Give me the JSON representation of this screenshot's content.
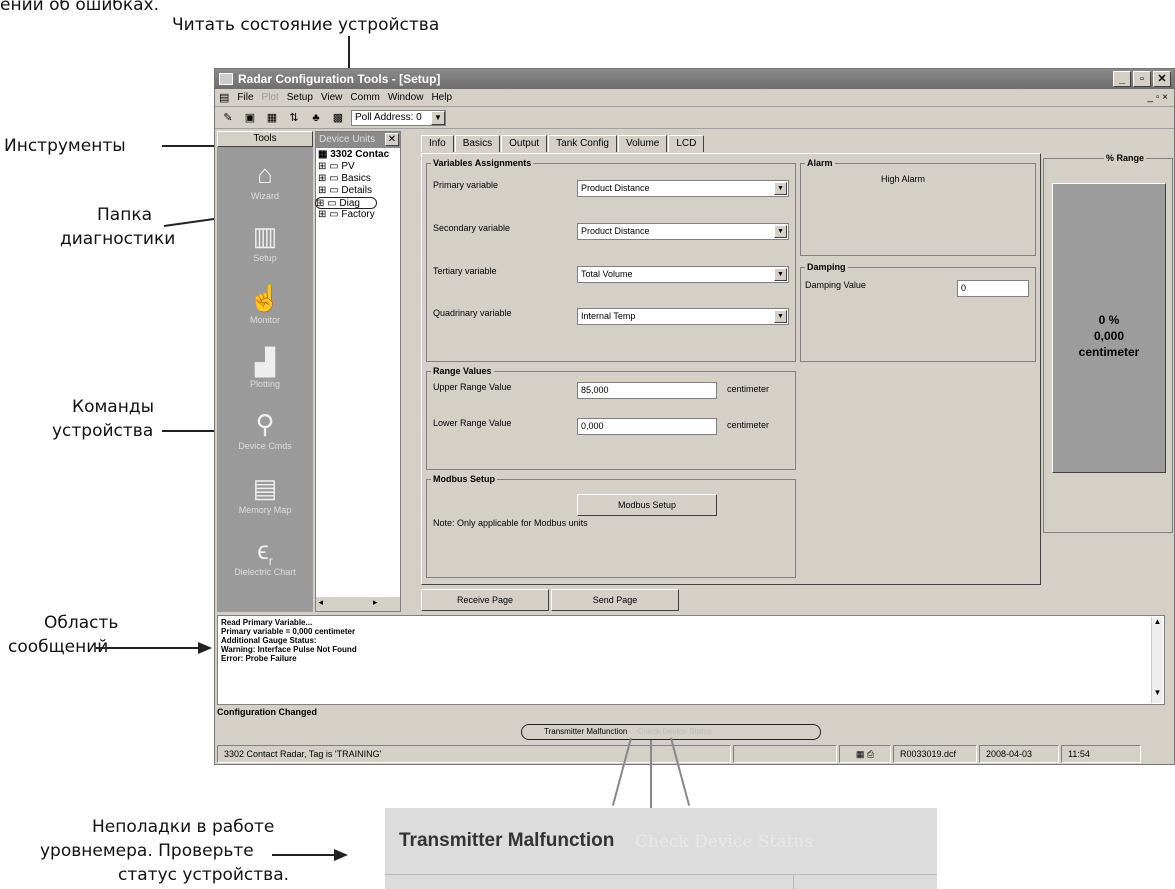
{
  "callouts": {
    "top_partial": "ении об ошибках.",
    "read_status": "Читать состояние устройства",
    "tools": "Инструменты",
    "diag_folder_1": "Папка",
    "diag_folder_2": "диагностики",
    "commands_1": "Команды",
    "commands_2": "устройства",
    "message_1": "Область",
    "message_2": "сообщений",
    "malfunction_1": "Неполадки в работе",
    "malfunction_2": "уровнемера. Проверьте",
    "malfunction_3": "статус устройства."
  },
  "window": {
    "title": "Radar Configuration Tools - [Setup]",
    "buttons": [
      "_",
      "▫",
      "✕"
    ]
  },
  "menu": [
    "File",
    "Plot",
    "Setup",
    "View",
    "Comm",
    "Window",
    "Help"
  ],
  "menu_dim": [
    "Plot"
  ],
  "toolbar": {
    "poll_address": "Poll Address: 0"
  },
  "tools": {
    "header": "Tools",
    "items": [
      {
        "label": "Wizard",
        "icon": "wizard-icon"
      },
      {
        "label": "Setup",
        "icon": "setup-icon"
      },
      {
        "label": "Monitor",
        "icon": "monitor-icon"
      },
      {
        "label": "Plotting",
        "icon": "plotting-icon"
      },
      {
        "label": "Device Cmds",
        "icon": "device-commands-icon"
      },
      {
        "label": "Memory Map",
        "icon": "memory-map-icon"
      },
      {
        "label": "Dielectric Chart",
        "icon": "dielectric-icon"
      }
    ]
  },
  "tree": {
    "header": "Device Units",
    "root": "3302 Contac",
    "items": [
      "PV",
      "Basics",
      "Details",
      "Diag",
      "Factory"
    ]
  },
  "tabs": [
    "Info",
    "Basics",
    "Output",
    "Tank Config",
    "Volume",
    "LCD"
  ],
  "variables": {
    "legend": "Variables Assignments",
    "rows": [
      {
        "label": "Primary variable",
        "value": "Product Distance"
      },
      {
        "label": "Secondary variable",
        "value": "Product Distance"
      },
      {
        "label": "Tertiary variable",
        "value": "Total Volume"
      },
      {
        "label": "Quadrinary variable",
        "value": "Internal Temp"
      }
    ]
  },
  "alarm": {
    "legend": "Alarm",
    "value": "High Alarm"
  },
  "damping": {
    "legend": "Damping",
    "label": "Damping Value",
    "value": "0"
  },
  "range": {
    "legend": "% Range",
    "percent": "0 %",
    "value": "0,000",
    "unit": "centimeter"
  },
  "range_values": {
    "legend": "Range Values",
    "upper_label": "Upper Range Value",
    "upper_value": "85,000",
    "lower_label": "Lower Range Value",
    "lower_value": "0,000",
    "unit": "centimeter"
  },
  "modbus": {
    "legend": "Modbus Setup",
    "button": "Modbus Setup",
    "note": "Note: Only applicable for Modbus units"
  },
  "page_buttons": {
    "receive": "Receive Page",
    "send": "Send Page"
  },
  "messages": [
    "Read Primary Variable...",
    "Primary variable = 0,000 centimeter",
    "Additional Gauge Status:",
    "Warning: Interface Pulse Not Found",
    "Error: Probe Failure"
  ],
  "config_changed": "Configuration Changed",
  "status_pill": {
    "active": "Transmitter Malfunction",
    "inactive": "Check Device Status"
  },
  "statusbar": {
    "device": "3302 Contact Radar,  Tag is 'TRAINING'",
    "file": "R0033019.dcf",
    "date": "2008-04-03",
    "time": "11:54"
  },
  "zoom": {
    "active": "Transmitter Malfunction",
    "inactive": "Check Device Status"
  }
}
